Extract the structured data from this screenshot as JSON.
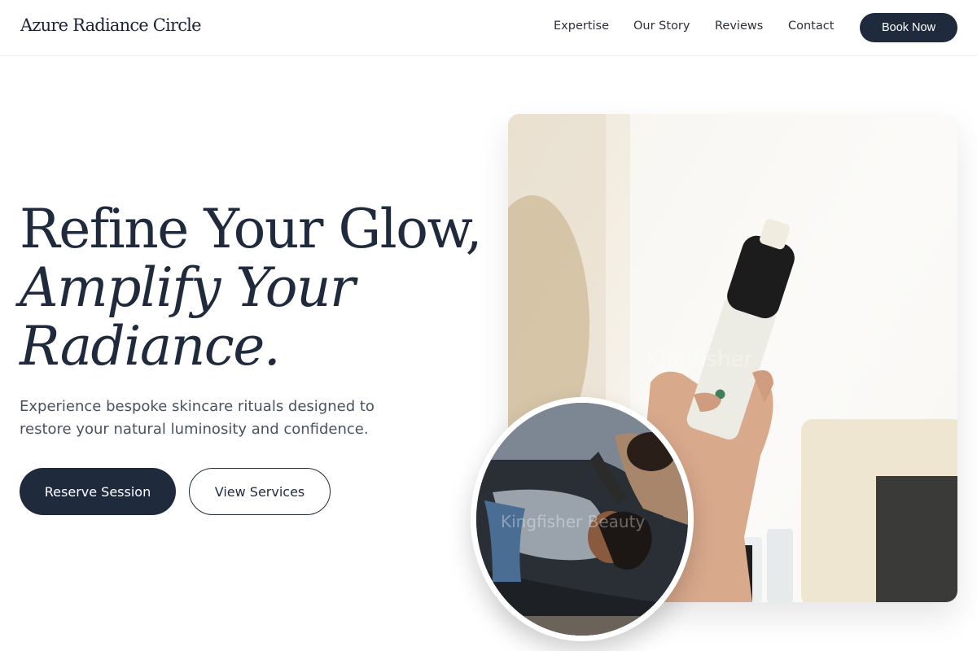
{
  "brand": {
    "name": "Azure Radiance Circle"
  },
  "nav": {
    "links": [
      "Expertise",
      "Our Story",
      "Reviews",
      "Contact"
    ],
    "cta": "Book Now"
  },
  "hero": {
    "title_line1": "Refine Your Glow,",
    "title_line2": "Amplify Your",
    "title_line3": "Radiance.",
    "subtitle": "Experience bespoke skincare rituals designed to restore your natural luminosity and confidence.",
    "primary_cta": "Reserve Session",
    "secondary_cta": "View Services"
  },
  "images": {
    "main_alt": "Hand holding a skincare device",
    "main_watermark": "Kingfisher",
    "circle_alt": "Client receiving a facial treatment",
    "circle_watermark": "Kingfisher Beauty"
  },
  "colors": {
    "primary": "#1f2a3d",
    "background": "#ffffff",
    "text_muted": "#4a5160"
  }
}
